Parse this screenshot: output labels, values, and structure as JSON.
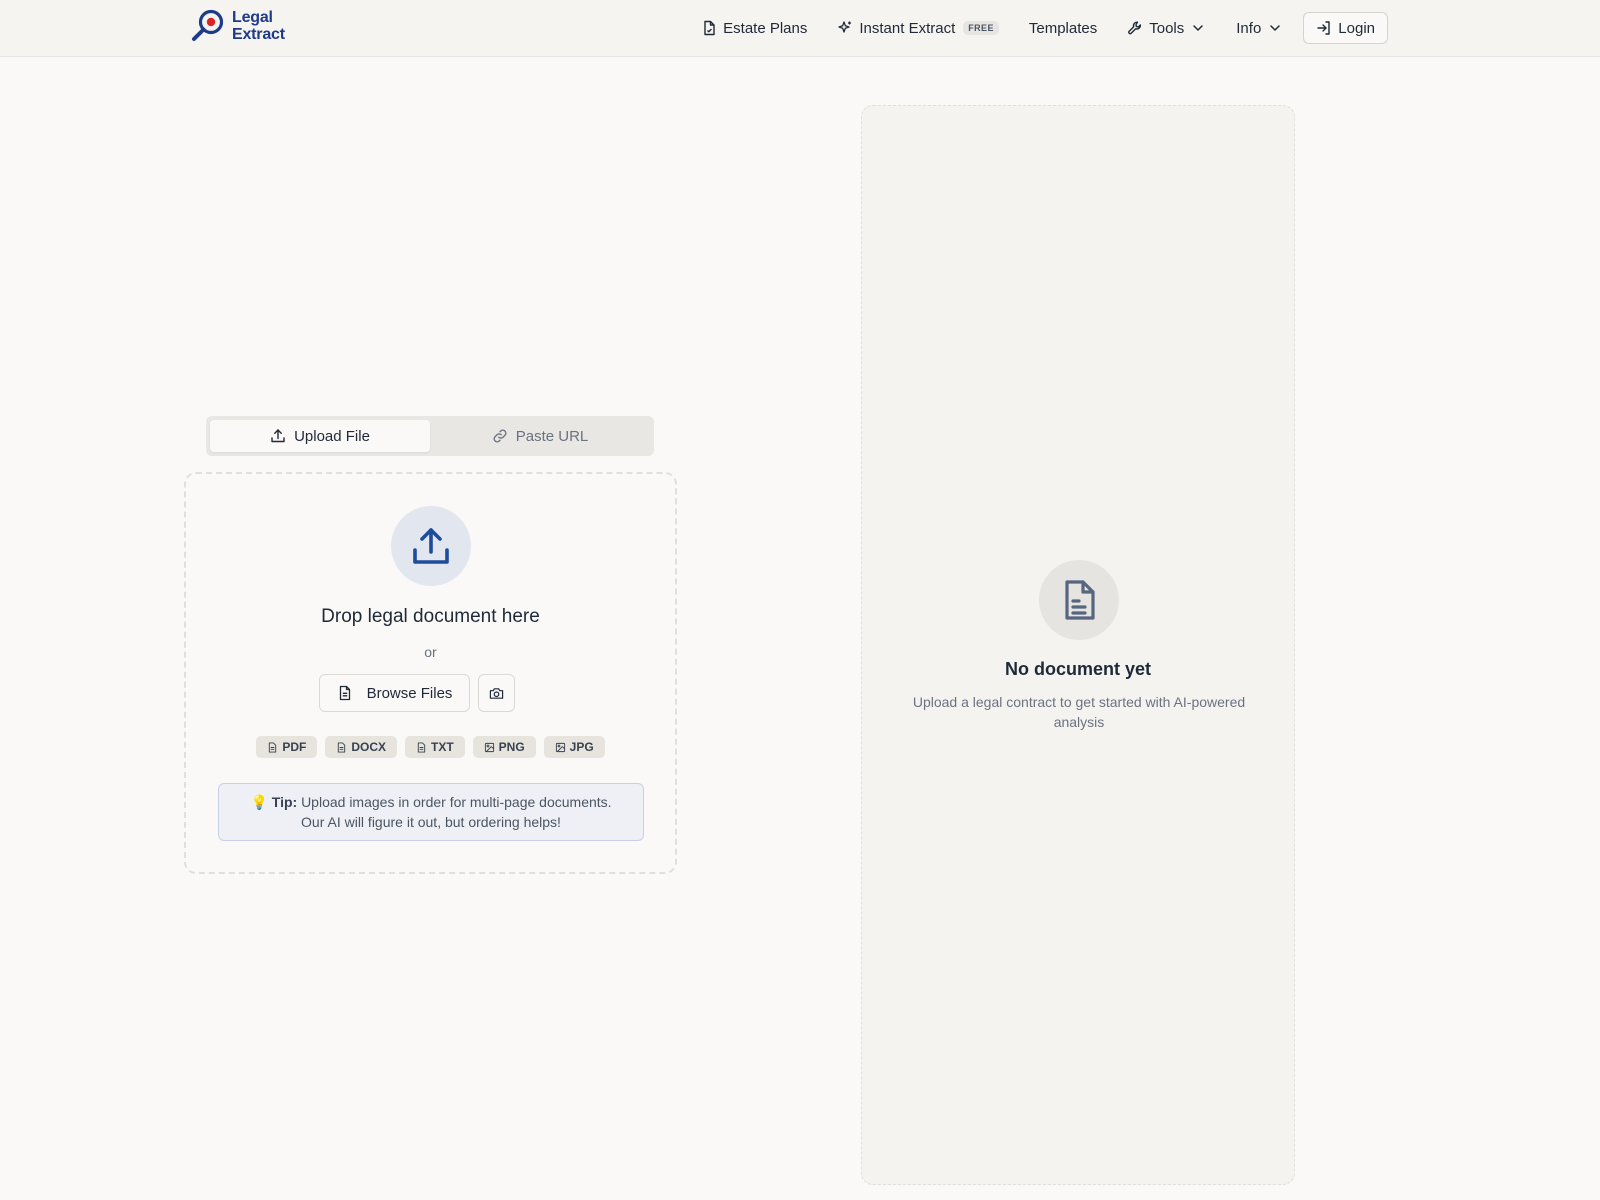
{
  "header": {
    "logo": {
      "line1": "Legal",
      "line2": "Extract"
    },
    "nav": {
      "estate_plans": "Estate Plans",
      "instant_extract": "Instant Extract",
      "free_badge": "FREE",
      "templates": "Templates",
      "tools": "Tools",
      "info": "Info",
      "login": "Login"
    }
  },
  "upload": {
    "tabs": {
      "upload_file": "Upload File",
      "paste_url": "Paste URL"
    },
    "drop_title": "Drop legal document here",
    "or": "or",
    "browse": "Browse Files",
    "formats": [
      "PDF",
      "DOCX",
      "TXT",
      "PNG",
      "JPG"
    ],
    "tip_label": "Tip:",
    "tip_line1": "Upload images in order for multi-page documents.",
    "tip_line2": "Our AI will figure it out, but ordering helps!"
  },
  "document_panel": {
    "title": "No document yet",
    "subtitle": "Upload a legal contract to get started with AI-powered analysis"
  },
  "colors": {
    "brand": "#1e3a8a",
    "logo_dot": "#dc2626",
    "background": "#faf9f7"
  }
}
